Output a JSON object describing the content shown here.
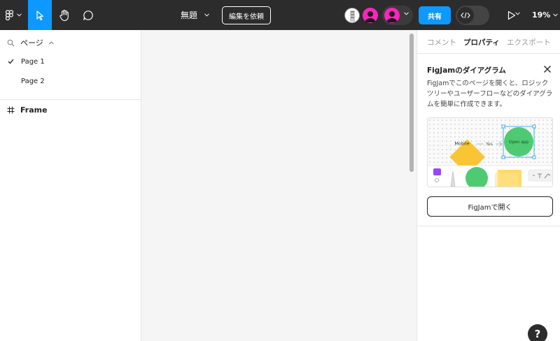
{
  "toolbar": {
    "file_title": "無題",
    "request_edit_label": "編集を依頼",
    "share_label": "共有",
    "zoom_label": "19%",
    "icons": [
      "figma-menu-icon",
      "move-tool-icon",
      "hand-tool-icon",
      "comment-icon",
      "code-icon",
      "play-icon"
    ]
  },
  "left_panel": {
    "pages_label": "ページ",
    "pages": [
      {
        "label": "Page 1",
        "selected": true
      },
      {
        "label": "Page 2",
        "selected": false
      }
    ],
    "layers": [
      {
        "label": "Frame",
        "icon": "frame-icon"
      }
    ]
  },
  "right_panel": {
    "tabs": [
      "コメント",
      "プロパティ",
      "エクスポート"
    ],
    "active_tab": "プロパティ",
    "card": {
      "title": "FigJamのダイアグラム",
      "description": "FigJamでこのページを開くと、ロジックツリーやユーザーフローなどのダイアグラムを簡単に作成できます。",
      "preview": {
        "diamond_label": "Mobile",
        "edge_label": "Yes",
        "circle_label": "Open app"
      },
      "button_label": "FigJamで開く"
    }
  },
  "help_label": "?",
  "colors": {
    "toolbar_bg": "#2c2c2c",
    "accent": "#0d99ff",
    "avatar_pink": "#ff24bd",
    "canvas_bg": "#f5f5f5",
    "diamond": "#f9c535",
    "circle": "#4ecb72"
  }
}
